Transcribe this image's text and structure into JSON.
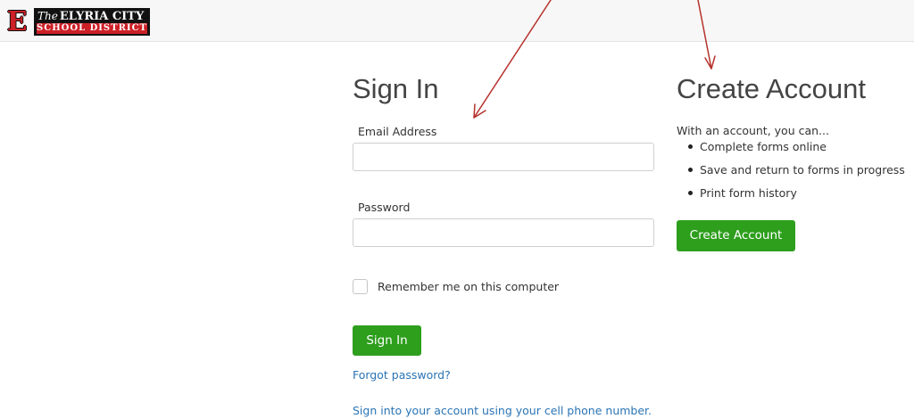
{
  "header": {
    "logo": {
      "letter": "E",
      "line1_prefix": "The",
      "line1_name": "ELYRIA CITY",
      "line2": "SCHOOL DISTRICT"
    }
  },
  "signin": {
    "title": "Sign In",
    "email_label": "Email Address",
    "email_value": "",
    "password_label": "Password",
    "password_value": "",
    "remember_label": "Remember me on this computer",
    "remember_checked": false,
    "submit_label": "Sign In",
    "forgot_link": "Forgot password?",
    "cell_link": "Sign into your account using your cell phone number."
  },
  "create_account": {
    "title": "Create Account",
    "intro": "With an account, you can...",
    "benefits": [
      "Complete forms online",
      "Save and return to forms in progress",
      "Print form history"
    ],
    "button_label": "Create Account"
  },
  "colors": {
    "button_green": "#2e9e1d",
    "link_blue": "#2a74b5",
    "logo_red": "#cc1f26",
    "annotation_arrow": "#b5322c"
  }
}
